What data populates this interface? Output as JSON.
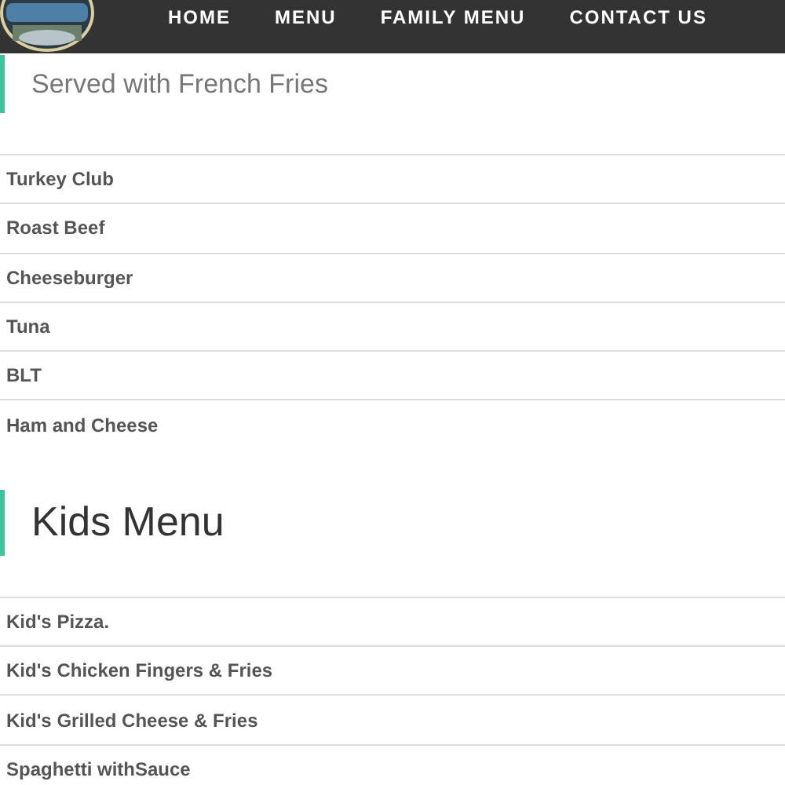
{
  "nav": {
    "links": [
      {
        "label": "HOME"
      },
      {
        "label": "MENU"
      },
      {
        "label": "FAMILY MENU"
      },
      {
        "label": "CONTACT US"
      }
    ]
  },
  "sections": [
    {
      "kind": "subtitle",
      "text": "Served with French Fries",
      "items": [
        "Turkey Club",
        "Roast Beef",
        "Cheeseburger",
        "Tuna",
        "BLT",
        "Ham and Cheese"
      ]
    },
    {
      "kind": "heading",
      "text": "Kids Menu",
      "items": [
        "Kid's Pizza.",
        "Kid's Chicken Fingers & Fries",
        "Kid's Grilled Cheese & Fries",
        "Spaghetti withSauce"
      ]
    }
  ]
}
